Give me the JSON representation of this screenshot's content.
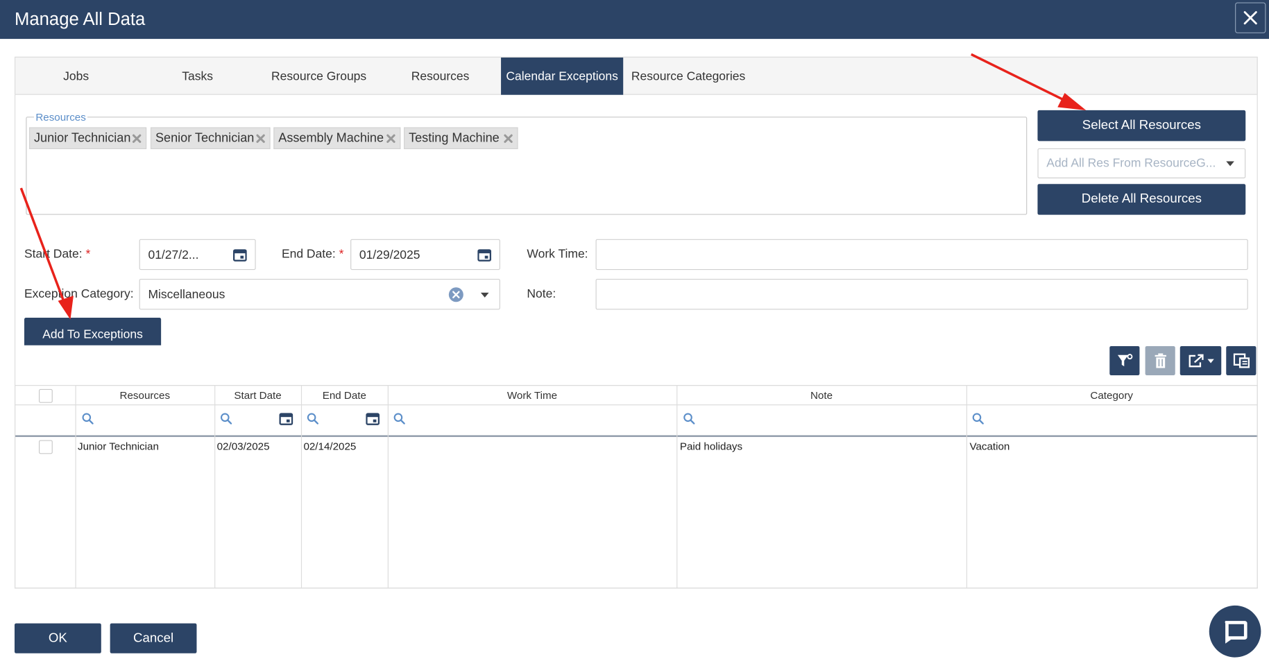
{
  "window": {
    "title": "Manage All Data"
  },
  "tabs": [
    {
      "label": "Jobs"
    },
    {
      "label": "Tasks"
    },
    {
      "label": "Resource Groups"
    },
    {
      "label": "Resources"
    },
    {
      "label": "Calendar Exceptions",
      "active": true
    },
    {
      "label": "Resource Categories"
    }
  ],
  "resources_box": {
    "legend": "Resources",
    "chips": [
      "Junior Technician",
      "Senior Technician",
      "Assembly Machine",
      "Testing Machine"
    ]
  },
  "side_actions": {
    "select_all": "Select All Resources",
    "group_placeholder": "Add All Res From ResourceG...",
    "delete_all": "Delete All Resources"
  },
  "form": {
    "start_date_label": "Start Date:",
    "start_date_value": "01/27/2...",
    "end_date_label": "End Date:",
    "end_date_value": "01/29/2025",
    "work_time_label": "Work Time:",
    "work_time_value": "",
    "category_label": "Exception Category:",
    "category_value": "Miscellaneous",
    "note_label": "Note:",
    "note_value": "",
    "required_mark": "*",
    "add_button": "Add To Exceptions"
  },
  "grid": {
    "columns": [
      "Resources",
      "Start Date",
      "End Date",
      "Work Time",
      "Note",
      "Category"
    ],
    "rows": [
      {
        "resource": "Junior Technician",
        "start": "02/03/2025",
        "end": "02/14/2025",
        "work_time": "",
        "note": "Paid holidays",
        "category": "Vacation"
      }
    ]
  },
  "footer": {
    "ok": "OK",
    "cancel": "Cancel"
  },
  "colors": {
    "primary": "#2c4466",
    "annotation_arrow": "#e8221b"
  }
}
